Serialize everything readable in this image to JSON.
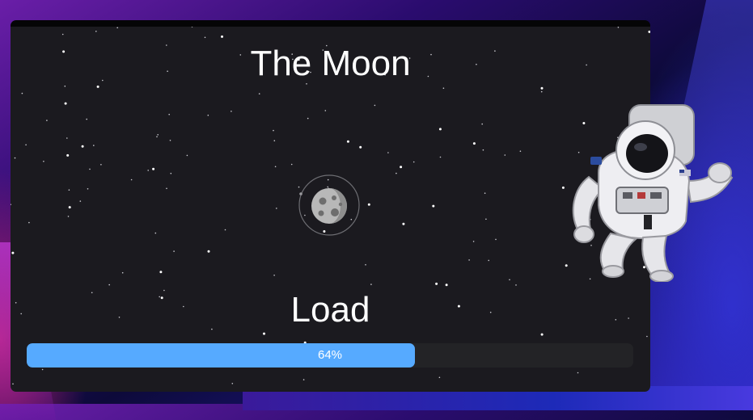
{
  "page": {
    "title": "The Moon",
    "load_label": "Load",
    "progress": {
      "percent": 64,
      "text": "64%"
    }
  },
  "icons": {
    "moon": "moon-icon",
    "orbit": "orbit-ring-icon",
    "astronaut": "astronaut-illustration"
  },
  "colors": {
    "window_bg": "#1b1a1f",
    "progress_fill": "#56aaff",
    "progress_track": "#232326",
    "text": "#ffffff",
    "moon": "#b8b8b8"
  }
}
